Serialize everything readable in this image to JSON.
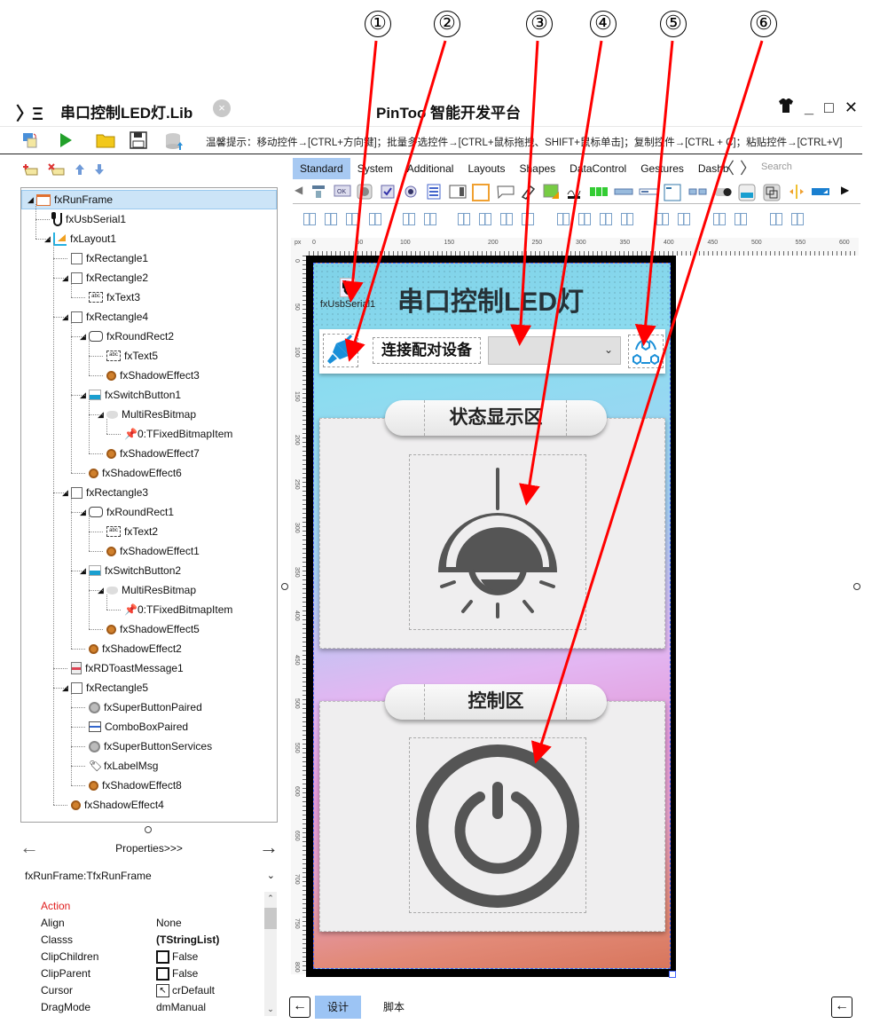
{
  "annotations": [
    "①",
    "②",
    "③",
    "④",
    "⑤",
    "⑥"
  ],
  "titlebar": {
    "app_logo": "〉Ξ",
    "document_title": "串口控制LED灯.Lib",
    "close_doc": "×",
    "app_title": "PinToo 智能开发平台",
    "skin_icon": "👕",
    "minimize": "_",
    "maximize": "□",
    "close": "✕"
  },
  "toolbar": {
    "hint": "温馨提示：移动控件→[CTRL+方向键]；批量多选控件→[CTRL+鼠标拖拽、SHIFT+鼠标单击]；复制控件→[CTRL + C]；粘贴控件→[CTRL+V]"
  },
  "tree_tools": [
    "add-node",
    "delete-node",
    "move-up",
    "move-down"
  ],
  "tree": [
    {
      "label": "fxRunFrame",
      "icon": "frame",
      "level": 0,
      "expanded": true,
      "selected": true
    },
    {
      "label": "fxUsbSerial1",
      "icon": "usb",
      "level": 1
    },
    {
      "label": "fxLayout1",
      "icon": "layout",
      "level": 1,
      "expanded": true
    },
    {
      "label": "fxRectangle1",
      "icon": "box",
      "level": 2
    },
    {
      "label": "fxRectangle2",
      "icon": "box",
      "level": 2,
      "expanded": true
    },
    {
      "label": "fxText3",
      "icon": "text",
      "level": 3
    },
    {
      "label": "fxRectangle4",
      "icon": "box",
      "level": 2,
      "expanded": true
    },
    {
      "label": "fxRoundRect2",
      "icon": "rrect",
      "level": 3,
      "expanded": true
    },
    {
      "label": "fxText5",
      "icon": "text",
      "level": 4
    },
    {
      "label": "fxShadowEffect3",
      "icon": "shadow",
      "level": 4
    },
    {
      "label": "fxSwitchButton1",
      "icon": "switch",
      "level": 3,
      "expanded": true
    },
    {
      "label": "MultiResBitmap",
      "icon": "bitmap",
      "level": 4,
      "expanded": true
    },
    {
      "label": "0:TFixedBitmapItem",
      "icon": "pin",
      "level": 5
    },
    {
      "label": "fxShadowEffect7",
      "icon": "shadow",
      "level": 4
    },
    {
      "label": "fxShadowEffect6",
      "icon": "shadow",
      "level": 3
    },
    {
      "label": "fxRectangle3",
      "icon": "box",
      "level": 2,
      "expanded": true
    },
    {
      "label": "fxRoundRect1",
      "icon": "rrect",
      "level": 3,
      "expanded": true
    },
    {
      "label": "fxText2",
      "icon": "text",
      "level": 4
    },
    {
      "label": "fxShadowEffect1",
      "icon": "shadow",
      "level": 4
    },
    {
      "label": "fxSwitchButton2",
      "icon": "switch",
      "level": 3,
      "expanded": true
    },
    {
      "label": "MultiResBitmap",
      "icon": "bitmap",
      "level": 4,
      "expanded": true
    },
    {
      "label": "0:TFixedBitmapItem",
      "icon": "pin",
      "level": 5
    },
    {
      "label": "fxShadowEffect5",
      "icon": "shadow",
      "level": 4
    },
    {
      "label": "fxShadowEffect2",
      "icon": "shadow",
      "level": 3
    },
    {
      "label": "fxRDToastMessage1",
      "icon": "toast",
      "level": 2
    },
    {
      "label": "fxRectangle5",
      "icon": "box",
      "level": 2,
      "expanded": true
    },
    {
      "label": "fxSuperButtonPaired",
      "icon": "gear",
      "level": 3
    },
    {
      "label": "ComboBoxPaired",
      "icon": "combo",
      "level": 3
    },
    {
      "label": "fxSuperButtonServices",
      "icon": "gear",
      "level": 3
    },
    {
      "label": "fxLabelMsg",
      "icon": "label",
      "level": 3
    },
    {
      "label": "fxShadowEffect8",
      "icon": "shadow",
      "level": 3
    },
    {
      "label": "fxShadowEffect4",
      "icon": "shadow",
      "level": 2
    }
  ],
  "properties": {
    "nav_title": "Properties>>>",
    "back_arrow": "←",
    "forward_arrow": "→",
    "object": "fxRunFrame:TfxRunFrame",
    "rows": [
      {
        "key": "Action",
        "value": "",
        "highlight": true
      },
      {
        "key": "Align",
        "value": "None"
      },
      {
        "key": "Classs",
        "value": "(TStringList)",
        "bold": true
      },
      {
        "key": "ClipChildren",
        "value": "False",
        "checkbox": true
      },
      {
        "key": "ClipParent",
        "value": "False",
        "checkbox": true
      },
      {
        "key": "Cursor",
        "value": "crDefault",
        "cursor": true
      },
      {
        "key": "DragMode",
        "value": "dmManual"
      }
    ]
  },
  "palette": {
    "tabs": [
      "Standard",
      "System",
      "Additional",
      "Layouts",
      "Shapes",
      "DataControl",
      "Gestures",
      "Dashb"
    ],
    "active_tab": "Standard",
    "prev": "〈",
    "next": "〉",
    "search_placeholder": "Search"
  },
  "ruler": {
    "unit": "px",
    "h_labels": [
      "0",
      "50",
      "100",
      "150",
      "200",
      "250",
      "300",
      "350",
      "400",
      "450",
      "500",
      "550",
      "600"
    ],
    "v_labels": [
      "0",
      "50",
      "100",
      "150",
      "200",
      "250",
      "300",
      "350",
      "400",
      "450",
      "500",
      "550",
      "600",
      "650",
      "700",
      "750",
      "800"
    ]
  },
  "canvas": {
    "main_title": "串口控制LED灯",
    "usb_component_label": "fxUsbSerial1",
    "connect_label": "连接配对设备",
    "combo_value": "",
    "status_section_title": "状态显示区",
    "control_section_title": "控制区",
    "colors": {
      "title_text": "#263238",
      "plug_icon": "#1a8fd8",
      "icon_gray": "#555555",
      "annotation_arrow": "#ff0000"
    }
  },
  "bottom_tabs": {
    "design": "设计",
    "script": "脚本",
    "active": "design"
  }
}
